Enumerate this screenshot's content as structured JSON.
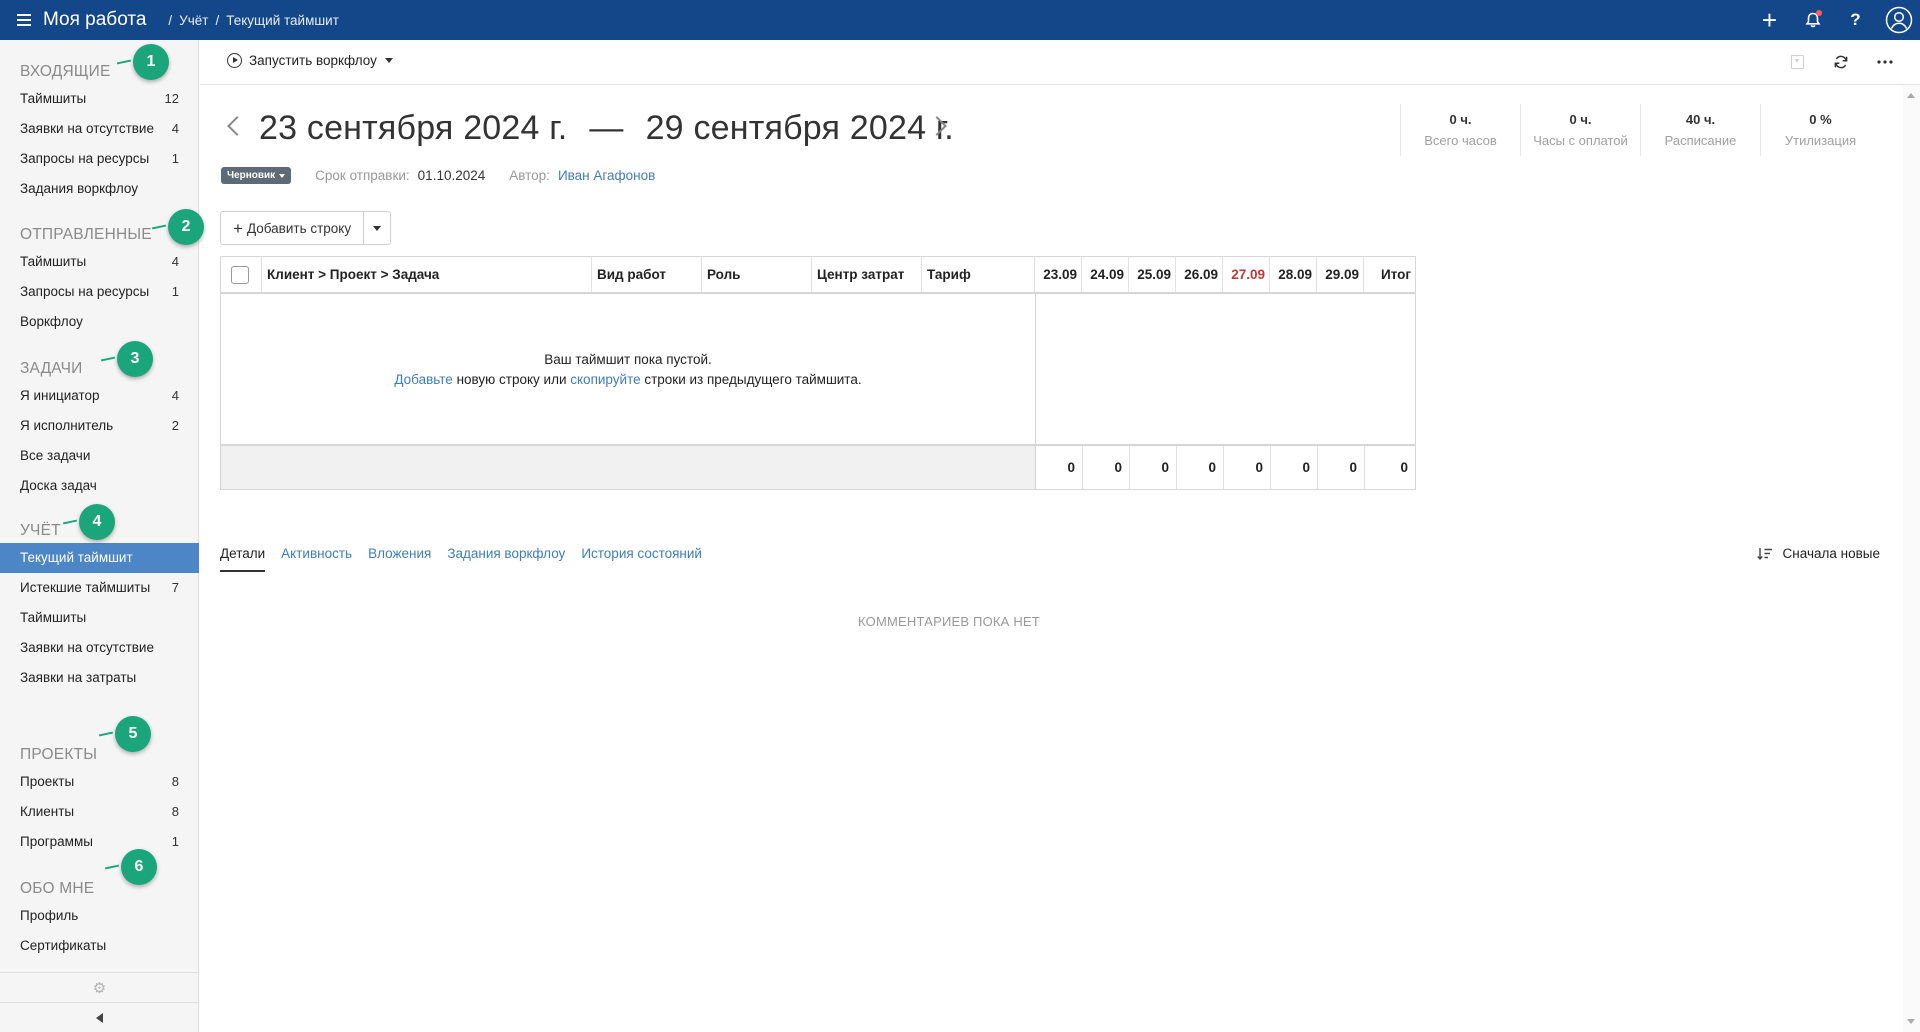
{
  "topbar": {
    "title": "Моя работа",
    "breadcrumb": [
      "Учёт",
      "Текущий таймшит"
    ],
    "separator": "/",
    "icons": [
      "plus-icon",
      "bell-icon",
      "help-icon",
      "user-icon"
    ],
    "notification_dot_color": "#ff5a5f",
    "bg_color": "#14478a"
  },
  "sidebar": {
    "sections": [
      {
        "heading": "ВХОДЯЩИЕ",
        "callout": "1",
        "items": [
          {
            "label": "Таймшиты",
            "count": "12"
          },
          {
            "label": "Заявки на отсутствие",
            "count": "4"
          },
          {
            "label": "Запросы на ресурсы",
            "count": "1"
          },
          {
            "label": "Задания воркфлоу",
            "count": ""
          }
        ]
      },
      {
        "heading": "ОТПРАВЛЕННЫЕ",
        "callout": "2",
        "items": [
          {
            "label": "Таймшиты",
            "count": "4"
          },
          {
            "label": "Запросы на ресурсы",
            "count": "1"
          },
          {
            "label": "Воркфлоу",
            "count": ""
          }
        ]
      },
      {
        "heading": "ЗАДАЧИ",
        "callout": "3",
        "items": [
          {
            "label": "Я инициатор",
            "count": "4"
          },
          {
            "label": "Я исполнитель",
            "count": "2"
          },
          {
            "label": "Все задачи",
            "count": ""
          },
          {
            "label": "Доска задач",
            "count": ""
          }
        ]
      },
      {
        "heading": "УЧЁТ",
        "callout": "4",
        "items": [
          {
            "label": "Текущий таймшит",
            "count": "",
            "active": true
          },
          {
            "label": "Истекшие таймшиты",
            "count": "7"
          },
          {
            "label": "Таймшиты",
            "count": ""
          },
          {
            "label": "Заявки на отсутствие",
            "count": ""
          },
          {
            "label": "Заявки на затраты",
            "count": ""
          }
        ]
      },
      {
        "heading": "ПРОЕКТЫ",
        "callout": "5",
        "items": [
          {
            "label": "Проекты",
            "count": "8"
          },
          {
            "label": "Клиенты",
            "count": "8"
          },
          {
            "label": "Программы",
            "count": "1"
          }
        ]
      },
      {
        "heading": "ОБО МНЕ",
        "callout": "6",
        "items": [
          {
            "label": "Профиль",
            "count": ""
          },
          {
            "label": "Сертификаты",
            "count": ""
          }
        ]
      }
    ],
    "active_color": "#4d86c6",
    "callout_color": "#1aa57a"
  },
  "toolbar": {
    "workflow_label": "Запустить воркфлоу",
    "icons": [
      "export-icon",
      "refresh-icon",
      "more-icon"
    ]
  },
  "header": {
    "period_start": "23 сентября 2024 г.",
    "period_dash": "—",
    "period_end": "29 сентября 2024 г.",
    "status_badge": "Черновик",
    "due_label": "Срок отправки:",
    "due_value": "01.10.2024",
    "author_label": "Автор:",
    "author_value": "Иван Агафонов"
  },
  "stats": [
    {
      "value": "0 ч.",
      "label": "Всего часов"
    },
    {
      "value": "0 ч.",
      "label": "Часы с оплатой"
    },
    {
      "value": "40 ч.",
      "label": "Расписание"
    },
    {
      "value": "0 %",
      "label": "Утилизация"
    }
  ],
  "add_row": {
    "label": "Добавить строку"
  },
  "grid": {
    "columns": {
      "task": "Клиент > Проект > Задача",
      "work_type": "Вид работ",
      "role": "Роль",
      "cost_center": "Центр затрат",
      "rate": "Тариф",
      "total": "Итог"
    },
    "days": [
      {
        "label": "23.09",
        "weekend": false
      },
      {
        "label": "24.09",
        "weekend": false
      },
      {
        "label": "25.09",
        "weekend": false
      },
      {
        "label": "26.09",
        "weekend": false
      },
      {
        "label": "27.09",
        "weekend": true
      },
      {
        "label": "28.09",
        "weekend": false
      },
      {
        "label": "29.09",
        "weekend": false
      }
    ],
    "weekend_color": "#c0393b",
    "empty": {
      "line1": "Ваш таймшит пока пустой.",
      "link1": "Добавьте",
      "mid": " новую строку или ",
      "link2": "скопируйте",
      "tail": " строки из предыдущего таймшита."
    },
    "totals": [
      "0",
      "0",
      "0",
      "0",
      "0",
      "0",
      "0",
      "0"
    ]
  },
  "tabs": [
    {
      "label": "Детали",
      "active": true
    },
    {
      "label": "Активность",
      "active": false
    },
    {
      "label": "Вложения",
      "active": false
    },
    {
      "label": "Задания воркфлоу",
      "active": false
    },
    {
      "label": "История состояний",
      "active": false
    }
  ],
  "sort_label": "Сначала новые",
  "no_comments": "КОММЕНТАРИЕВ ПОКА НЕТ"
}
